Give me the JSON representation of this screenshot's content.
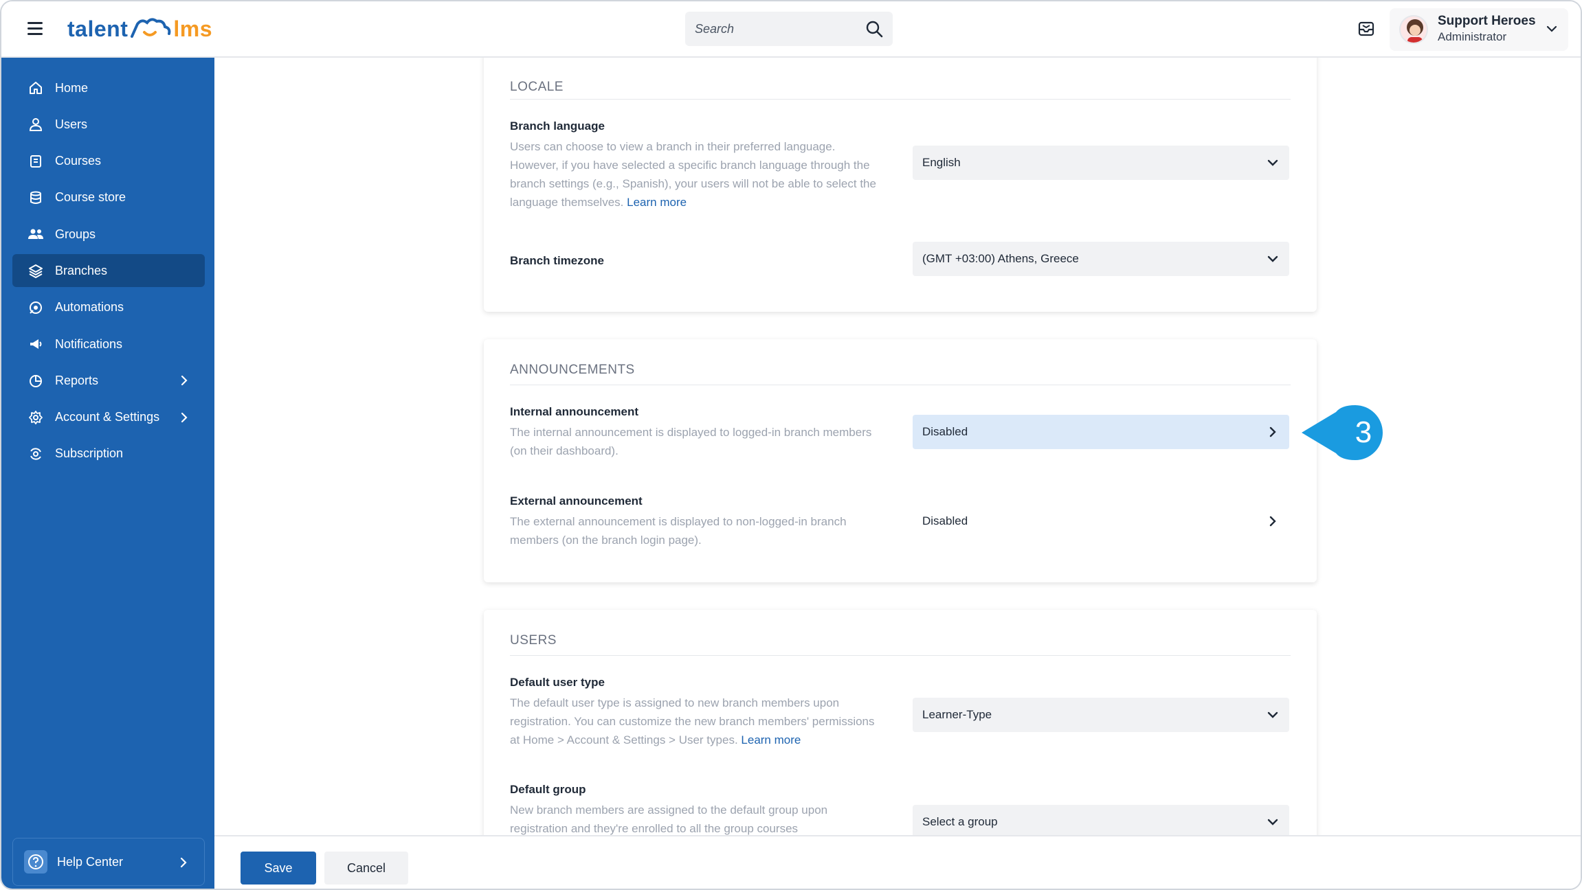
{
  "app": {
    "logo_left": "talent",
    "logo_right": "lms"
  },
  "header": {
    "search_placeholder": "Search",
    "user_name": "Support Heroes",
    "user_role": "Administrator"
  },
  "sidebar": {
    "items": [
      {
        "label": "Home",
        "icon": "home-icon"
      },
      {
        "label": "Users",
        "icon": "user-icon"
      },
      {
        "label": "Courses",
        "icon": "book-icon"
      },
      {
        "label": "Course store",
        "icon": "store-icon"
      },
      {
        "label": "Groups",
        "icon": "groups-icon"
      },
      {
        "label": "Branches",
        "icon": "branches-icon",
        "active": true
      },
      {
        "label": "Automations",
        "icon": "automations-icon"
      },
      {
        "label": "Notifications",
        "icon": "megaphone-icon"
      },
      {
        "label": "Reports",
        "icon": "pie-chart-icon",
        "submenu": true
      },
      {
        "label": "Account & Settings",
        "icon": "gear-icon",
        "submenu": true
      },
      {
        "label": "Subscription",
        "icon": "subscription-icon"
      }
    ],
    "help_label": "Help Center"
  },
  "locale": {
    "title": "LOCALE",
    "language_label": "Branch language",
    "language_desc": "Users can choose to view a branch in their preferred language. However, if you have selected a specific branch language through the branch settings (e.g., Spanish), your users will not be able to select the language themselves.",
    "language_learn_more": "Learn more",
    "language_value": "English",
    "timezone_label": "Branch timezone",
    "timezone_value": "(GMT +03:00) Athens, Greece"
  },
  "announcements": {
    "title": "ANNOUNCEMENTS",
    "internal_label": "Internal announcement",
    "internal_desc": "The internal announcement is displayed to logged-in branch members (on their dashboard).",
    "internal_value": "Disabled",
    "external_label": "External announcement",
    "external_desc": "The external announcement is displayed to non-logged-in branch members (on the branch login page).",
    "external_value": "Disabled"
  },
  "users": {
    "title": "USERS",
    "user_type_label": "Default user type",
    "user_type_desc": "The default user type is assigned to new branch members upon registration. You can customize the new branch members' permissions at Home > Account & Settings > User types.",
    "user_type_learn_more": "Learn more",
    "user_type_value": "Learner-Type",
    "group_label": "Default group",
    "group_desc": "New branch members are assigned to the default group upon registration and they're enrolled to all the group courses",
    "group_value": "Select a group"
  },
  "footer": {
    "save_label": "Save",
    "cancel_label": "Cancel"
  },
  "callout": {
    "step": "3",
    "color": "#1a9be0"
  },
  "colors": {
    "brand": "#1d63b0",
    "logo_accent": "#f59a23",
    "highlight": "#dbe9f9"
  }
}
